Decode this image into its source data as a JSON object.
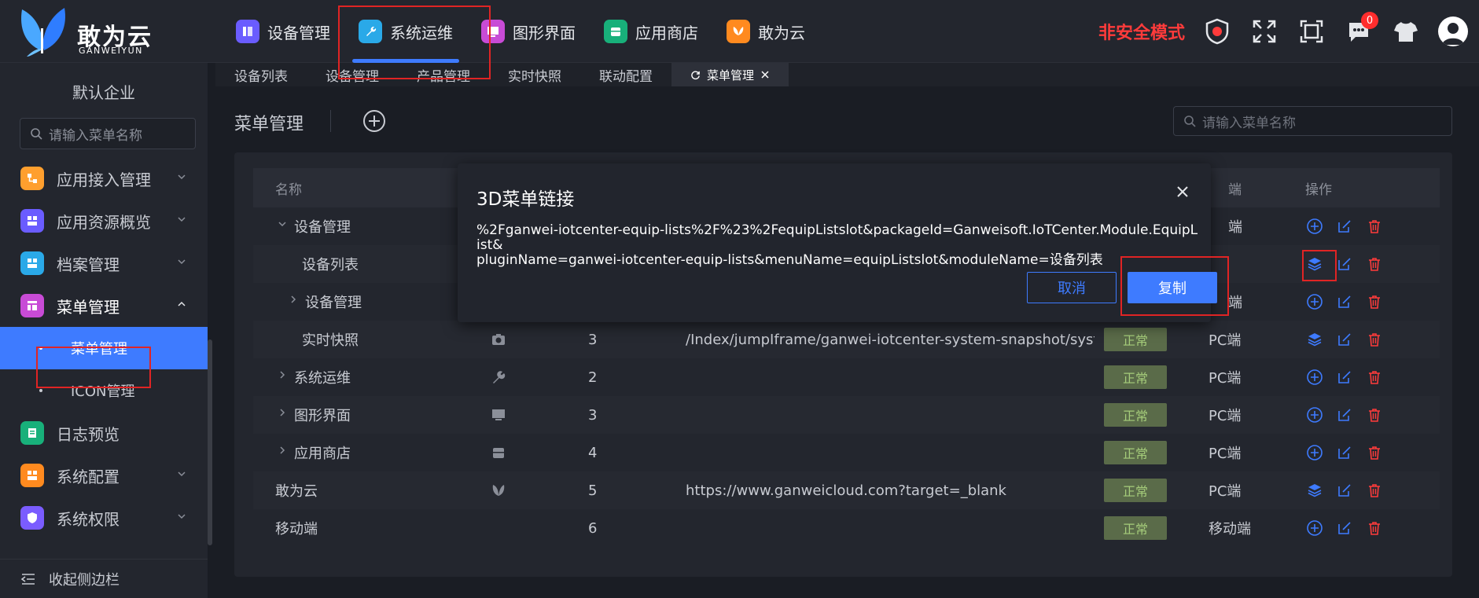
{
  "brand": {
    "name": "敢为云",
    "sub": "GANWEIYUN"
  },
  "topnav": [
    {
      "label": "设备管理",
      "color": "#6a5cff"
    },
    {
      "label": "系统运维",
      "color": "#2aa9e8",
      "active": true
    },
    {
      "label": "图形界面",
      "color": "#c84bd6"
    },
    {
      "label": "应用商店",
      "color": "#18b07a"
    },
    {
      "label": "敢为云",
      "color": "#ff8a1f"
    }
  ],
  "topright": {
    "unsafe_label": "非安全模式",
    "badge_count": "0"
  },
  "sidebar": {
    "enterprise": "默认企业",
    "search_placeholder": "请输入菜单名称",
    "items": [
      {
        "label": "应用接入管理",
        "color": "#ff9f2e"
      },
      {
        "label": "应用资源概览",
        "color": "#6a5cff"
      },
      {
        "label": "档案管理",
        "color": "#2aa9e8"
      },
      {
        "label": "菜单管理",
        "color": "#c84bd6"
      },
      {
        "label": "日志预览",
        "color": "#18b07a"
      },
      {
        "label": "系统配置",
        "color": "#ff8a1f"
      },
      {
        "label": "系统权限",
        "color": "#7a5cff"
      }
    ],
    "sub_items": [
      "菜单管理",
      "ICON管理"
    ],
    "collapse_label": "收起侧边栏"
  },
  "tabs": [
    "设备列表",
    "设备管理",
    "产品管理",
    "实时快照",
    "联动配置",
    "菜单管理"
  ],
  "main": {
    "title": "菜单管理",
    "search_placeholder": "请输入菜单名称",
    "headers": {
      "name": "名称",
      "terminal": "端",
      "ops": "操作"
    },
    "rows": [
      {
        "name": "设备管理",
        "order": "",
        "path": "",
        "status": "",
        "term": "端"
      },
      {
        "name": "设备列表",
        "order": "",
        "path": "",
        "status": "",
        "term": ""
      },
      {
        "name": "设备管理",
        "order": "",
        "path": "",
        "status": "",
        "term": "端"
      },
      {
        "name": "实时快照",
        "order": "3",
        "path": "/Index/jumpIframe/ganwei-iotcenter-system-snapshot/system",
        "status": "正常",
        "term": "PC端"
      },
      {
        "name": "系统运维",
        "order": "2",
        "path": "",
        "status": "正常",
        "term": "PC端"
      },
      {
        "name": "图形界面",
        "order": "3",
        "path": "",
        "status": "正常",
        "term": "PC端"
      },
      {
        "name": "应用商店",
        "order": "4",
        "path": "",
        "status": "正常",
        "term": "PC端"
      },
      {
        "name": "敢为云",
        "order": "5",
        "path": "https://www.ganweicloud.com?target=_blank",
        "status": "正常",
        "term": "PC端"
      },
      {
        "name": "移动端",
        "order": "6",
        "path": "",
        "status": "正常",
        "term": "移动端"
      }
    ]
  },
  "dialog": {
    "title": "3D菜单链接",
    "line1": "%2Fganwei-iotcenter-equip-lists%2F%23%2FequipListslot&packageId=Ganweisoft.IoTCenter.Module.EquipList&",
    "line2": "pluginName=ganwei-iotcenter-equip-lists&menuName=equipListslot&moduleName=设备列表",
    "cancel": "取消",
    "copy": "复制"
  }
}
